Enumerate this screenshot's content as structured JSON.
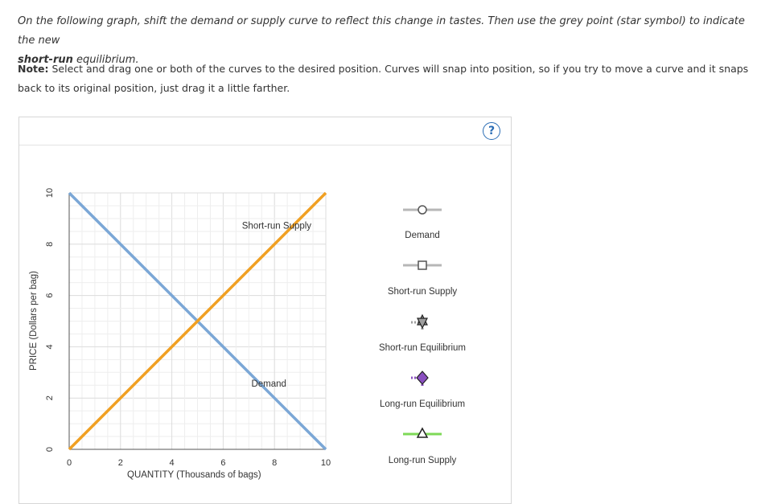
{
  "instructions": {
    "line1": "On the following graph, shift the demand or supply curve to reflect this change in tastes. Then use the grey point (star symbol) to indicate the new",
    "line2_bold": "short-run",
    "line2_rest": " equilibrium."
  },
  "note": {
    "label": "Note:",
    "text": " Select and drag one or both of the curves to the desired position. Curves will snap into position, so if you try to move a curve and it snaps back to its original position, just drag it a little farther."
  },
  "help_icon": "?",
  "chart_data": {
    "type": "line",
    "xlabel": "QUANTITY (Thousands of bags)",
    "ylabel": "PRICE (Dollars per bag)",
    "xlim": [
      0,
      10
    ],
    "ylim": [
      0,
      10
    ],
    "x_ticks": [
      "0",
      "2",
      "4",
      "6",
      "8",
      "10"
    ],
    "y_ticks": [
      "0",
      "2",
      "4",
      "6",
      "8",
      "10"
    ],
    "grid": true,
    "series": [
      {
        "name": "Demand",
        "color": "#7ba7d6",
        "points": [
          [
            0,
            10
          ],
          [
            10,
            0
          ]
        ],
        "label": "Demand"
      },
      {
        "name": "Short-run Supply",
        "color": "#f0a023",
        "points": [
          [
            0,
            0
          ],
          [
            10,
            10
          ]
        ],
        "label": "Short-run Supply"
      }
    ]
  },
  "legend": [
    {
      "label": "Demand",
      "icon": "circle-marker",
      "color": "#b7b7b7"
    },
    {
      "label": "Short-run Supply",
      "icon": "square-marker",
      "color": "#b7b7b7"
    },
    {
      "label": "Short-run Equilibrium",
      "icon": "star-marker",
      "color": "#9e9e9e"
    },
    {
      "label": "Long-run Equilibrium",
      "icon": "diamond-marker",
      "color": "#8a4fc0"
    },
    {
      "label": "Long-run Supply",
      "icon": "triangle-marker",
      "color": "#7ed957"
    }
  ]
}
